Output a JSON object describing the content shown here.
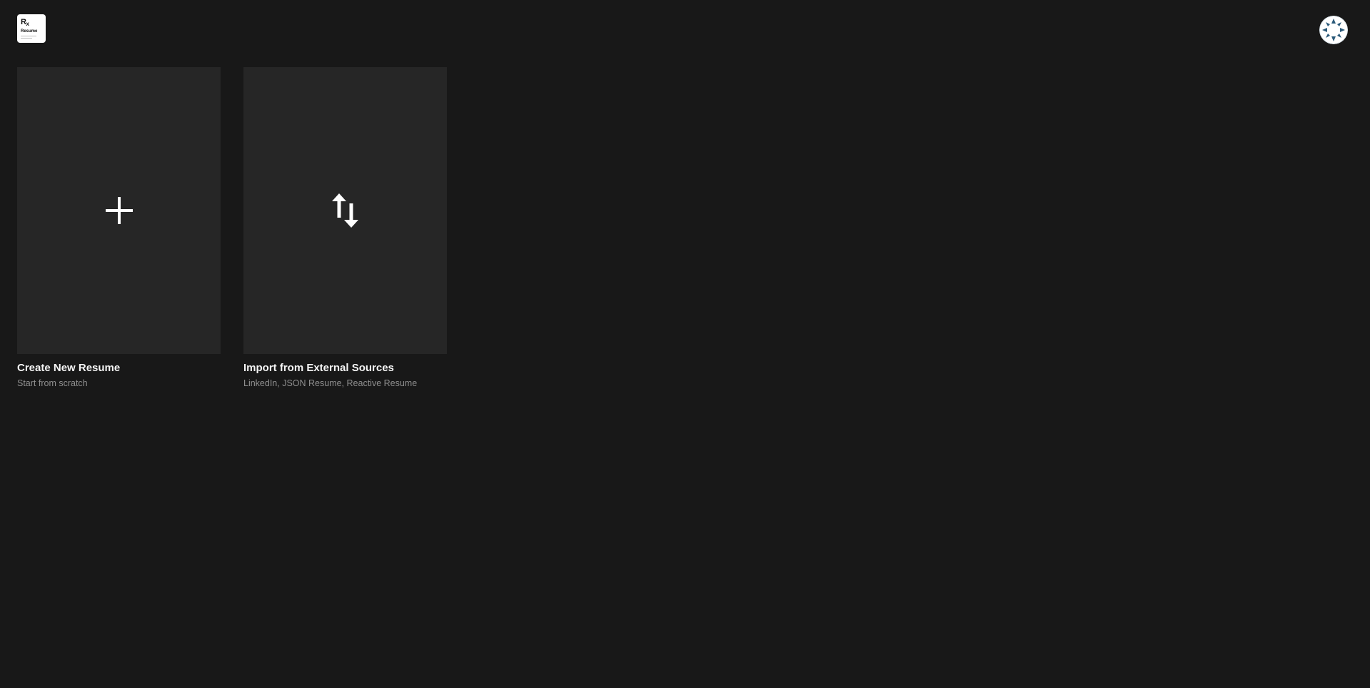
{
  "app": {
    "logo": {
      "rx_r": "R",
      "rx_x": "x",
      "name": "Resume"
    }
  },
  "user": {
    "avatar_icon": "user-avatar-icon"
  },
  "cards": [
    {
      "title": "Create New Resume",
      "subtitle": "Start from scratch",
      "icon": "plus-icon"
    },
    {
      "title": "Import from External Sources",
      "subtitle": "LinkedIn, JSON Resume, Reactive Resume",
      "icon": "arrows-up-down-icon"
    }
  ],
  "colors": {
    "background": "#181818",
    "card": "#262626",
    "title": "#f5f5f5",
    "subtitle": "#8f8f8f",
    "avatar_accent": "#2b5a7a"
  }
}
